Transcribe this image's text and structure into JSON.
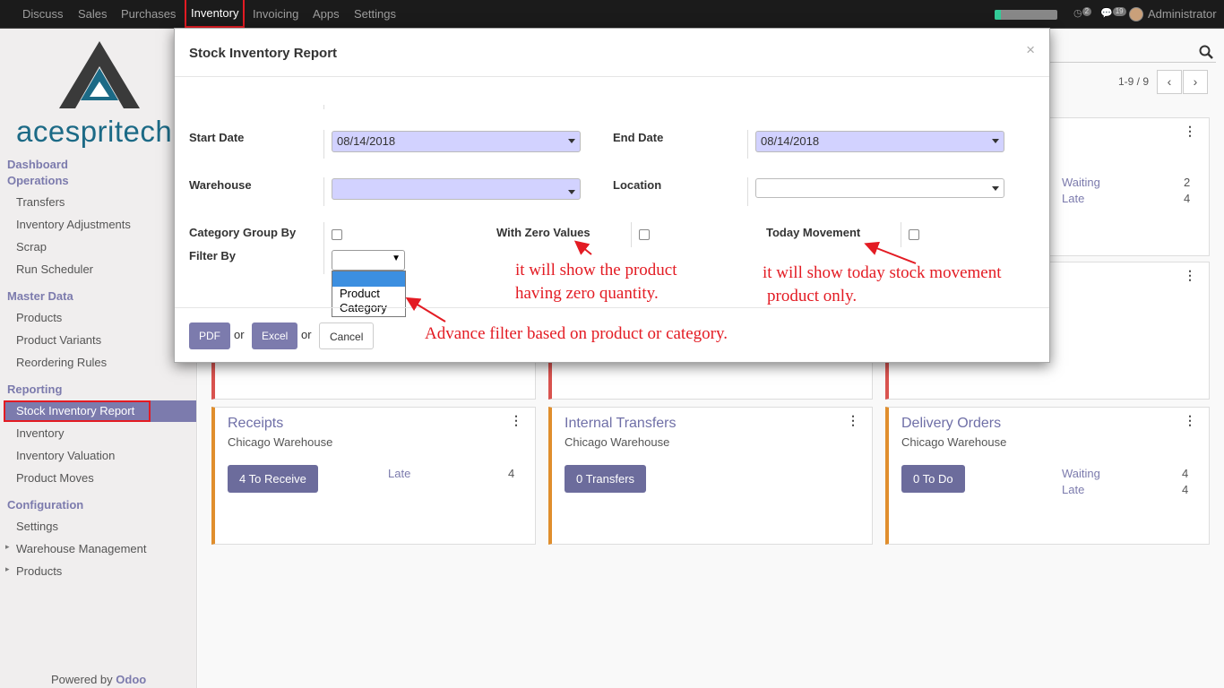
{
  "topbar": {
    "menu": [
      "Discuss",
      "Sales",
      "Purchases",
      "Inventory",
      "Invoicing",
      "Apps",
      "Settings"
    ],
    "active": "Inventory",
    "chat_count": "2",
    "msg_count": "19",
    "user": "Administrator",
    "progress_fraction": 0.1
  },
  "sidebar": {
    "logo_text": "acespritech",
    "sections": {
      "dashboard": "Dashboard",
      "operations": "Operations",
      "master": "Master Data",
      "reporting": "Reporting",
      "config": "Configuration"
    },
    "operations_items": [
      "Transfers",
      "Inventory Adjustments",
      "Scrap",
      "Run Scheduler"
    ],
    "master_items": [
      "Products",
      "Product Variants",
      "Reordering Rules"
    ],
    "reporting_items": [
      "Stock Inventory Report",
      "Inventory",
      "Inventory Valuation",
      "Product Moves"
    ],
    "config_items": [
      "Settings",
      "Warehouse Management",
      "Products"
    ],
    "powered_prefix": "Powered by",
    "powered_brand": "Odoo"
  },
  "main": {
    "pager": "1-9 / 9",
    "cards": [
      {
        "title": "Receipts",
        "sub": "Chicago Warehouse",
        "button": "4 To Receive",
        "stats": [
          {
            "label": "Late",
            "value": "4"
          }
        ]
      },
      {
        "title": "Internal Transfers",
        "sub": "Chicago Warehouse",
        "button": "0 Transfers",
        "stats": []
      },
      {
        "title": "Delivery Orders",
        "sub": "Chicago Warehouse",
        "button": "0 To Do",
        "stats": [
          {
            "label": "Waiting",
            "value": "4"
          },
          {
            "label": "Late",
            "value": "4"
          }
        ]
      }
    ],
    "top_right_card_stats": [
      {
        "label": "Waiting",
        "value": "2"
      },
      {
        "label": "Late",
        "value": "4"
      }
    ]
  },
  "modal": {
    "title": "Stock Inventory Report",
    "close": "×",
    "start_date_label": "Start Date",
    "start_date": "08/14/2018",
    "end_date_label": "End Date",
    "end_date": "08/14/2018",
    "warehouse_label": "Warehouse",
    "warehouse": "",
    "location_label": "Location",
    "location": "",
    "category_group_label": "Category Group By",
    "zero_values_label": "With Zero Values",
    "today_movement_label": "Today Movement",
    "filter_by_label": "Filter By",
    "filter_by_selected": "",
    "filter_options": [
      "Product",
      "Category"
    ],
    "pdf": "PDF",
    "excel": "Excel",
    "or": "or",
    "cancel": "Cancel"
  },
  "annotations": {
    "zero_line1": "it will show the product",
    "zero_line2": "having zero quantity.",
    "today_line1": "it will show today stock movement",
    "today_line2": "product only.",
    "filter_note": "Advance filter based on product or category."
  },
  "colors": {
    "accent": "#7c7bad",
    "date_field": "#d2d2ff",
    "highlight": "#e31b23",
    "topbar": "#1b1b1b"
  }
}
